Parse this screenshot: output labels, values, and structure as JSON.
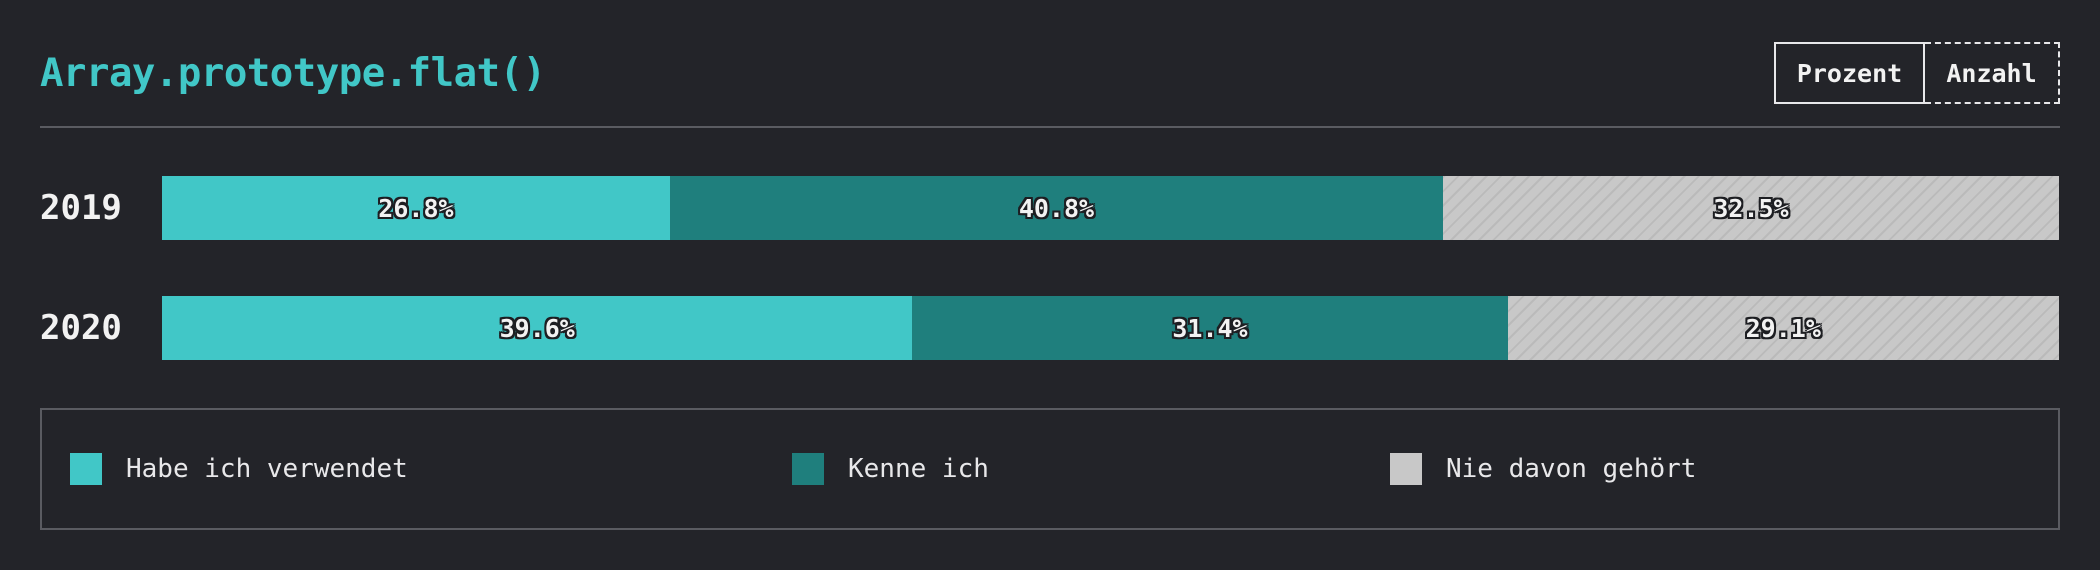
{
  "title": "Array.prototype.flat()",
  "toggle": {
    "percent_label": "Prozent",
    "count_label": "Anzahl"
  },
  "colors": {
    "used": "#41c7c7",
    "known": "#1f7f7d",
    "never": "#c8c8c8",
    "background": "#232429",
    "title": "#41c7c7"
  },
  "chart_data": {
    "type": "bar",
    "orientation": "horizontal",
    "stacked": true,
    "normalized": true,
    "categories": [
      "2019",
      "2020"
    ],
    "series": [
      {
        "name": "Habe ich verwendet",
        "values": [
          26.8,
          39.6
        ]
      },
      {
        "name": "Kenne ich",
        "values": [
          40.8,
          31.4
        ]
      },
      {
        "name": "Nie davon gehört",
        "values": [
          32.5,
          29.1
        ]
      }
    ],
    "labels": [
      [
        "26.8%",
        "40.8%",
        "32.5%"
      ],
      [
        "39.6%",
        "31.4%",
        "29.1%"
      ]
    ],
    "legend_position": "bottom"
  }
}
